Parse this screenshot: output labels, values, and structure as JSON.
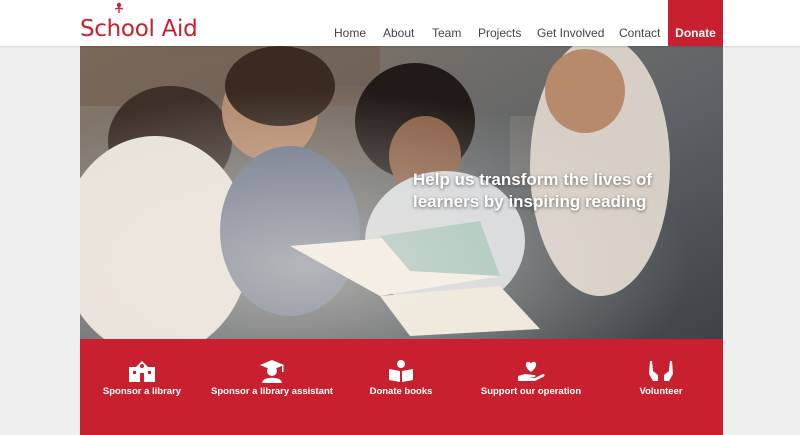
{
  "brand": {
    "name": "School Aid",
    "accent": "#c8202f"
  },
  "nav": {
    "items": [
      {
        "label": "Home"
      },
      {
        "label": "About"
      },
      {
        "label": "Team"
      },
      {
        "label": "Projects"
      },
      {
        "label": "Get Involved"
      },
      {
        "label": "Contact"
      }
    ],
    "donate_label": "Donate"
  },
  "hero": {
    "headline": "Help us transform the lives of learners by inspiring reading"
  },
  "actions": [
    {
      "label": "Sponsor a library",
      "icon": "school-building-icon"
    },
    {
      "label": "Sponsor a library assistant",
      "icon": "graduate-icon"
    },
    {
      "label": "Donate books",
      "icon": "open-book-icon"
    },
    {
      "label": "Support our operation",
      "icon": "heart-hand-icon"
    },
    {
      "label": "Volunteer",
      "icon": "raised-hands-icon"
    }
  ]
}
